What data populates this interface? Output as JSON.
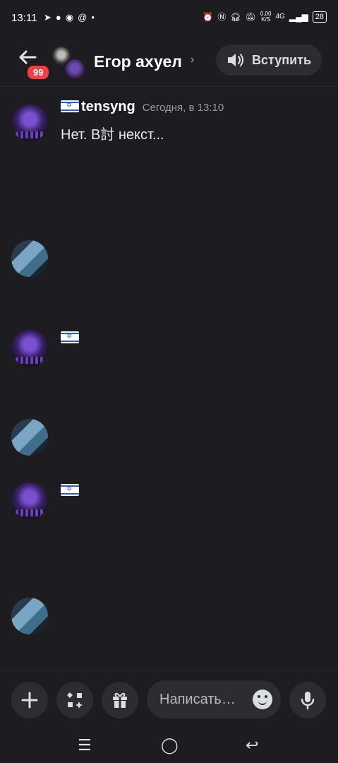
{
  "status_bar": {
    "time": "13:11",
    "left_icons": [
      "telegram-icon",
      "chat-icon",
      "discord-icon",
      "at-icon",
      "dot-icon"
    ],
    "net_speed": "0,00",
    "net_unit": "K/S",
    "network": "4G",
    "battery": "28"
  },
  "header": {
    "unread_badge": "99",
    "channel_name": "Егор ахуел",
    "join_label": "Вступить"
  },
  "messages": [
    {
      "author": "tensyng",
      "flag": true,
      "time": "Сегодня, в 13:10",
      "lines": [
        "Нет. В討 некст...",
        "",
        "",
        ""
      ]
    }
  ],
  "composer": {
    "placeholder": "Написать…"
  },
  "colors": {
    "background": "#1c1c21",
    "badge": "#f23f43",
    "button_bg": "#2b2d31"
  }
}
